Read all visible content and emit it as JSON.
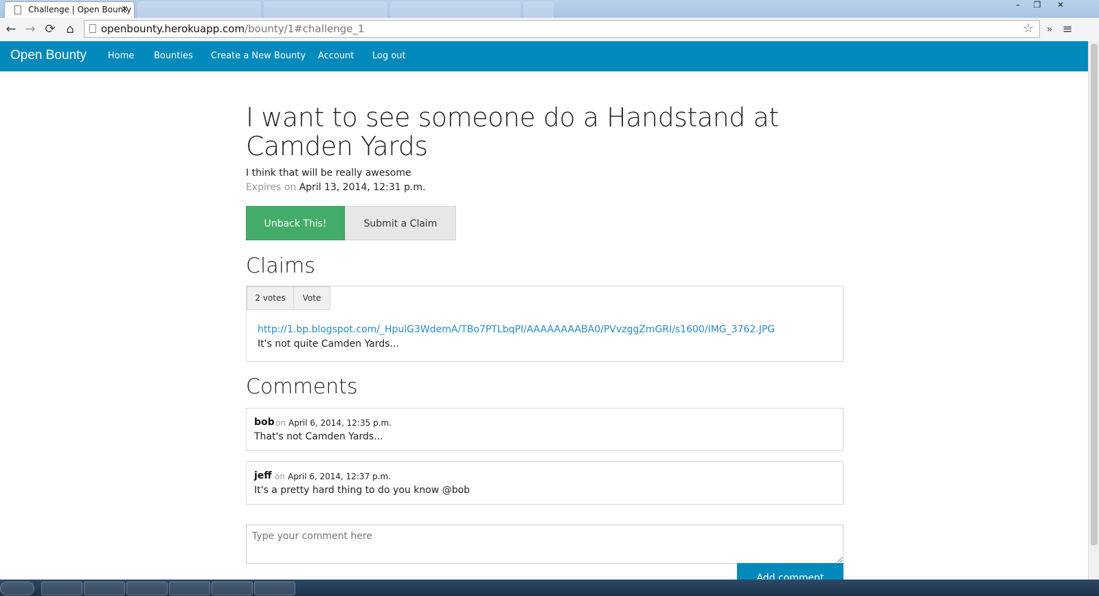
{
  "browser": {
    "active_tab": "Challenge | Open Bounty",
    "close_glyph": "×",
    "url_host": "openbounty.herokuapp.com",
    "url_path": "/bounty/1#challenge_1",
    "window_controls": [
      "–",
      "❐",
      "✕"
    ],
    "nav_icons": [
      "back-icon",
      "forward-icon",
      "reload-icon",
      "home-icon"
    ]
  },
  "navbar": {
    "brand": "Open Bounty",
    "links": [
      "Home",
      "Bounties",
      "Create a New Bounty",
      "Account",
      "Log out"
    ],
    "color": "#0289bb"
  },
  "bounty": {
    "title": "I want to see someone do a Handstand at Camden Yards",
    "description": "I think that will be really awesome",
    "expires_label": "Expires on",
    "expires_value": "April 13, 2014, 12:31 p.m."
  },
  "actions": {
    "unback": "Unback This!",
    "submit_claim": "Submit a Claim",
    "unback_color": "#43ac6a"
  },
  "claims": {
    "heading": "Claims",
    "items": [
      {
        "votes": "2 votes",
        "vote_label": "Vote",
        "link": "http://1.bp.blogspot.com/_HpulG3WdemA/TBo7PTLbqPI/AAAAAAAABA0/PVvzggZmGRI/s1600/IMG_3762.JPG",
        "text": "It's not quite Camden Yards..."
      }
    ]
  },
  "comments": {
    "heading": "Comments",
    "items": [
      {
        "author": "bob",
        "on": "on",
        "date": "April 6, 2014, 12:35 p.m.",
        "text": "That's not Camden Yards..."
      },
      {
        "author": "jeff",
        "on": "on",
        "date": "April 6, 2014, 12:37 p.m.",
        "text": "It's a pretty hard thing to do you know @bob"
      }
    ],
    "placeholder": "Type your comment here",
    "add_button": "Add comment"
  }
}
